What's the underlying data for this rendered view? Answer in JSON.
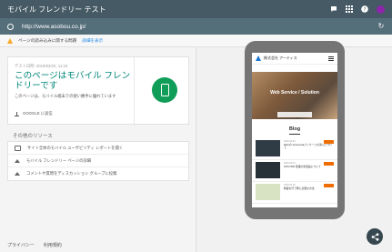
{
  "app": {
    "title": "モバイル フレンドリー テスト"
  },
  "header_icons": [
    "feedback-icon",
    "apps-grid-icon",
    "help-icon",
    "account-avatar"
  ],
  "colors": {
    "titlebar": "#455a64",
    "urlbar": "#546e7a",
    "accent_green": "#00897b",
    "phone_badge": "#0f9d58",
    "warning": "#f9a825",
    "avatar": "#8e24aa"
  },
  "urlbar": {
    "url": "http://www.asobou.co.jp/"
  },
  "warning": {
    "text": "ページの読み込みに関する問題",
    "link": "詳細を表示"
  },
  "result": {
    "date": "テスト日時: 2019/03/20, 11:19",
    "headline": "このページはモバイル フレンドリーです",
    "description": "このページは、モバイル端末での使い勝手に優れています",
    "share_label": "GOOGLE に送信"
  },
  "resources": {
    "title": "その他のリソース",
    "items": [
      {
        "icon": "chat-icon",
        "text": "サイト全体のモバイル ユーザビリティ レポートを開く"
      },
      {
        "icon": "graduation-cap-icon",
        "text": "モバイル フレンドリー ページの詳細"
      },
      {
        "icon": "graduation-cap-icon",
        "text": "コメントや質問をディスカッション グループに投稿"
      }
    ]
  },
  "footer": {
    "links": [
      "プライバシー",
      "利用規約"
    ]
  },
  "preview": {
    "site_name": "株式会社 アーティス",
    "tagline": "",
    "hero_title": "Web Service / Solution",
    "hero_subtitle": "",
    "hero_button": "",
    "blog_heading": "Blog",
    "posts": [
      {
        "date": "2019.03.20",
        "title": "Elixirの Anacondaパッケージの導入について"
      },
      {
        "date": "2019.03.19",
        "title": "UPLC300 型番の新製品について"
      },
      {
        "date": "2019.03.18",
        "title": "制御を行う際に必要な方法"
      }
    ]
  }
}
